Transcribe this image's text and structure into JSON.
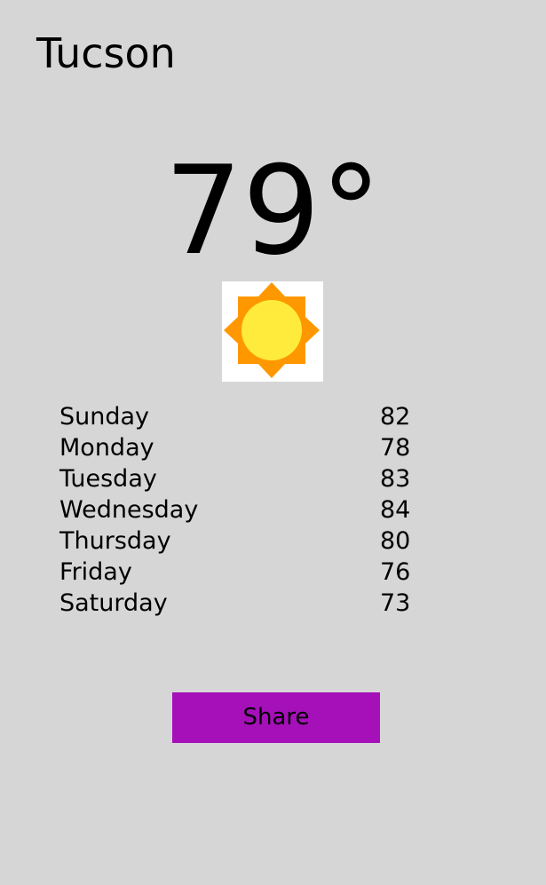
{
  "header": {
    "city": "Tucson"
  },
  "current": {
    "temperature": "79",
    "degree_symbol": "°",
    "condition_icon": "sun-icon"
  },
  "forecast": [
    {
      "day": "Sunday",
      "high": "82"
    },
    {
      "day": "Monday",
      "high": "78"
    },
    {
      "day": "Tuesday",
      "high": "83"
    },
    {
      "day": "Wednesday",
      "high": "84"
    },
    {
      "day": "Thursday",
      "high": "80"
    },
    {
      "day": "Friday",
      "high": "76"
    },
    {
      "day": "Saturday",
      "high": "73"
    }
  ],
  "actions": {
    "share_label": "Share"
  },
  "colors": {
    "background": "#d6d6d6",
    "share_button": "#a510b9",
    "sun_rays": "#ff9800",
    "sun_core": "#ffeb3b"
  }
}
